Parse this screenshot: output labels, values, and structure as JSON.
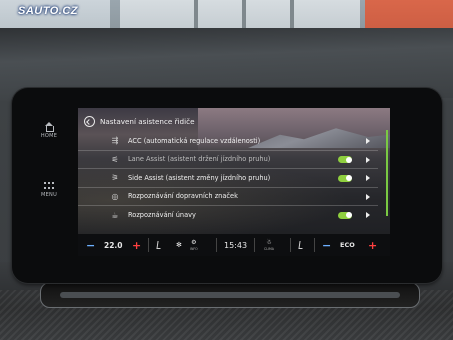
{
  "watermark": "SAUTO.CZ",
  "side_buttons": {
    "home_label": "HOME",
    "menu_label": "MENU"
  },
  "header": {
    "title": "Nastavení asistence řidiče"
  },
  "rows": [
    {
      "icon": "acc-icon",
      "label": "ACC (automatická regulace vzdálenosti)",
      "control": "chevron"
    },
    {
      "icon": "lane-assist-icon",
      "label": "Lane Assist (asistent držení jízdního pruhu)",
      "control": "toggle",
      "enabled": true
    },
    {
      "icon": "side-assist-icon",
      "label": "Side Assist (asistent změny jízdního pruhu)",
      "control": "toggle",
      "enabled": true
    },
    {
      "icon": "traffic-sign-icon",
      "label": "Rozpoznávání dopravních značek",
      "control": "chevron"
    },
    {
      "icon": "fatigue-icon",
      "label": "Rozpoznávání únavy",
      "control": "toggle",
      "enabled": true
    }
  ],
  "status_bar": {
    "minus_symbol": "−",
    "plus_symbol": "+",
    "temperature": "22.0",
    "info_label": "INFO",
    "time": "15:43",
    "clima_label": "CLIMA",
    "mode": "ECO"
  },
  "colors": {
    "toggle_on": "#8fcf3f",
    "minus": "#6db0ff",
    "plus": "#ff4040",
    "accent_bar": "#7ac943"
  }
}
